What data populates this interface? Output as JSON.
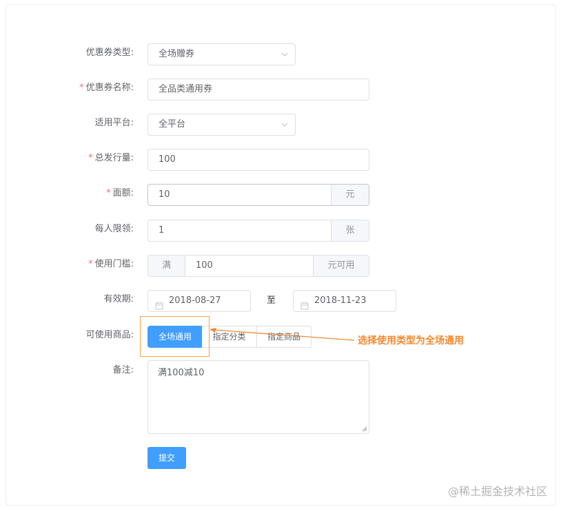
{
  "form": {
    "coupon_type": {
      "label": "优惠券类型:",
      "value": "全场赠券"
    },
    "coupon_name": {
      "label": "优惠券名称:",
      "value": "全品类通用券"
    },
    "platform": {
      "label": "适用平台:",
      "value": "全平台"
    },
    "total": {
      "label": "总发行量:",
      "value": "100"
    },
    "amount": {
      "label": "面额:",
      "value": "10",
      "suffix": "元"
    },
    "per_limit": {
      "label": "每人限领:",
      "value": "1",
      "suffix": "张"
    },
    "threshold": {
      "label": "使用门槛:",
      "prefix": "满",
      "value": "100",
      "suffix": "元可用"
    },
    "validity": {
      "label": "有效期:",
      "start": "2018-08-27",
      "separator": "至",
      "end": "2018-11-23"
    },
    "goods": {
      "label": "可使用商品:",
      "options": [
        "全场通用",
        "指定分类",
        "指定商品"
      ],
      "selected": "全场通用"
    },
    "note": {
      "label": "备注:",
      "value": "满100减10"
    },
    "submit_label": "提交",
    "required_mark": "*"
  },
  "annotation": {
    "text": "选择使用类型为全场通用",
    "color": "#f5882e"
  },
  "watermark": "@稀土掘金技术社区",
  "colors": {
    "primary": "#409eff",
    "required": "#f56c6c",
    "border": "#dcdfe6",
    "addon_bg": "#f5f7fa"
  }
}
